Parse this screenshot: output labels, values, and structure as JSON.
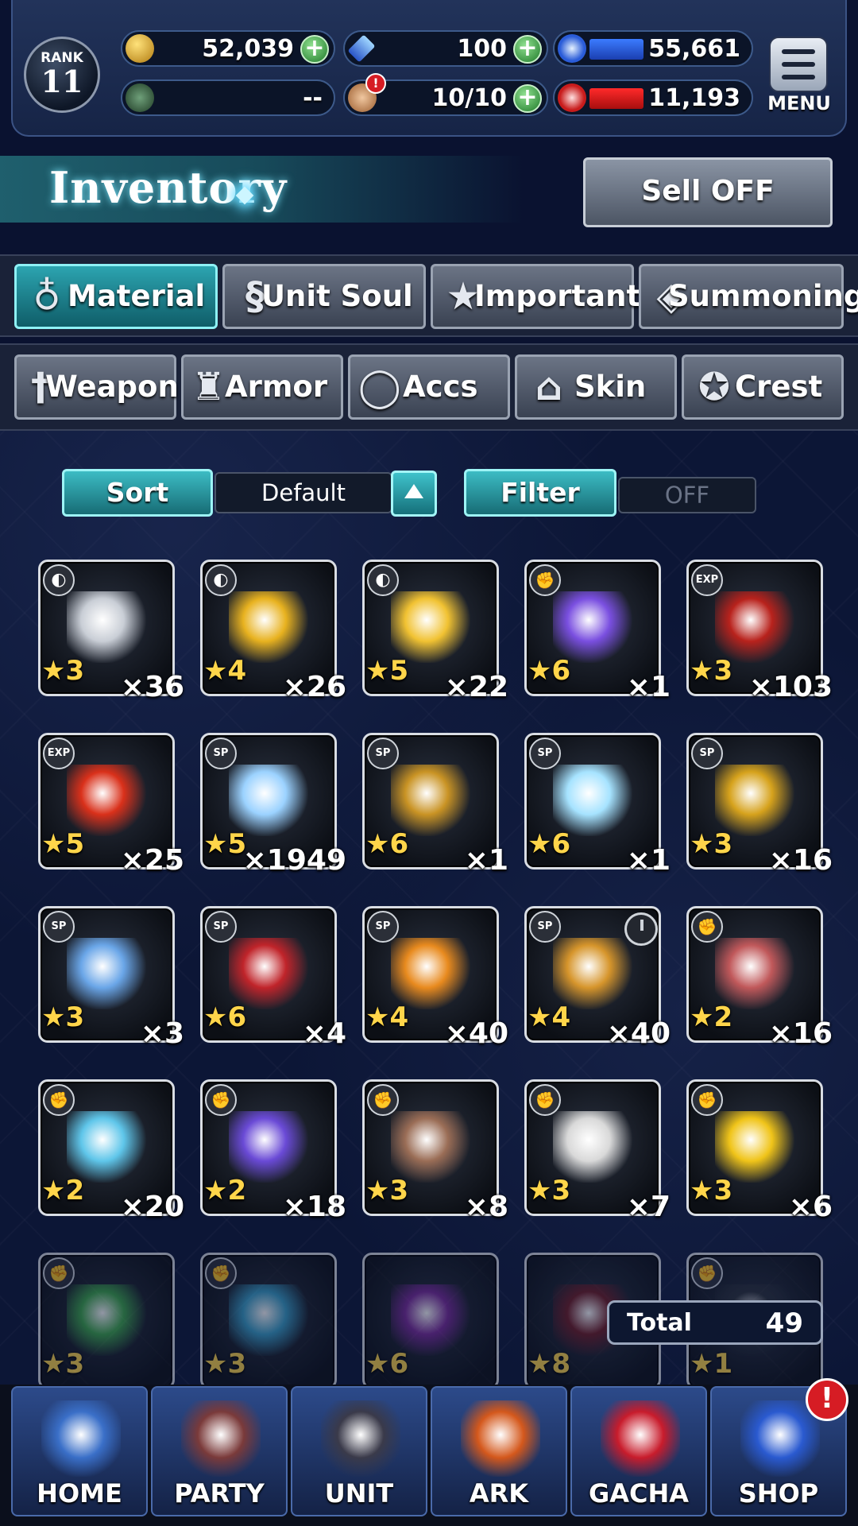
{
  "header": {
    "rank_label": "RANK",
    "rank_value": "11",
    "gold": "52,039",
    "crystals": "100",
    "blue_points": "55,661",
    "equipment": "--",
    "stamina": "10/10",
    "red_points": "11,193",
    "menu_label": "MENU"
  },
  "page": {
    "title": "Inventory",
    "sell_button": "Sell OFF"
  },
  "tabs_row1": [
    {
      "label": "Material",
      "icon": "bag-icon",
      "active": true
    },
    {
      "label": "Unit Soul",
      "icon": "soul-icon"
    },
    {
      "label": "Important",
      "icon": "star-icon"
    },
    {
      "label": "Summoning",
      "icon": "summon-icon"
    }
  ],
  "tabs_row2": [
    {
      "label": "Weapon",
      "icon": "sword-icon"
    },
    {
      "label": "Armor",
      "icon": "armor-icon"
    },
    {
      "label": "Accs",
      "icon": "ring-icon"
    },
    {
      "label": "Skin",
      "icon": "hanger-icon"
    },
    {
      "label": "Crest",
      "icon": "crest-icon"
    }
  ],
  "controls": {
    "sort_label": "Sort",
    "sort_value": "Default",
    "filter_label": "Filter",
    "filter_value": "OFF"
  },
  "items": [
    {
      "name": "silver-ingot",
      "rarity": "★3",
      "count": "×36",
      "badge": "ore",
      "color": "#c9ced6"
    },
    {
      "name": "gold-ingot",
      "rarity": "★4",
      "count": "×26",
      "badge": "ore",
      "color": "#e8b21f"
    },
    {
      "name": "gold-ingot-pile",
      "rarity": "★5",
      "count": "×22",
      "badge": "ore",
      "color": "#f1c232"
    },
    {
      "name": "rainbow-orb",
      "rarity": "★6",
      "count": "×1",
      "badge": "muscle",
      "color": "#7a4fe0"
    },
    {
      "name": "red-exp-potion",
      "rarity": "★3",
      "count": "×103",
      "badge": "EXP",
      "color": "#b8221c"
    },
    {
      "name": "flaming-exp-potion",
      "rarity": "★5",
      "count": "×25",
      "badge": "EXP",
      "color": "#d9301a"
    },
    {
      "name": "soul-mirror",
      "rarity": "★5",
      "count": "×1949",
      "badge": "SP",
      "color": "#9bd2ff"
    },
    {
      "name": "golden-relic",
      "rarity": "★6",
      "count": "×1",
      "badge": "SP",
      "color": "#c99324"
    },
    {
      "name": "prism-crystal",
      "rarity": "★6",
      "count": "×1",
      "badge": "SP",
      "color": "#a6e3ff"
    },
    {
      "name": "gold-ticket",
      "rarity": "★3",
      "count": "×16",
      "badge": "SP",
      "color": "#d6a21c"
    },
    {
      "name": "silver-ticket",
      "rarity": "★3",
      "count": "×3",
      "badge": "SP",
      "color": "#6aa6e8"
    },
    {
      "name": "red-ticket",
      "rarity": "★6",
      "count": "×4",
      "badge": "SP",
      "color": "#c0242a"
    },
    {
      "name": "orange-elixir",
      "rarity": "★4",
      "count": "×40",
      "badge": "SP",
      "color": "#e88a1e"
    },
    {
      "name": "green-elixir-timed",
      "rarity": "★4",
      "count": "×40",
      "badge": "SP",
      "color": "#d6952b",
      "timed": true
    },
    {
      "name": "meat-chunk",
      "rarity": "★2",
      "count": "×16",
      "badge": "muscle",
      "color": "#c0585a"
    },
    {
      "name": "blue-potion",
      "rarity": "★2",
      "count": "×20",
      "badge": "muscle",
      "color": "#5fc6ea"
    },
    {
      "name": "purple-crystals",
      "rarity": "★2",
      "count": "×18",
      "badge": "muscle",
      "color": "#6a4ad6"
    },
    {
      "name": "curled-horn",
      "rarity": "★3",
      "count": "×8",
      "badge": "muscle",
      "color": "#9a6d56"
    },
    {
      "name": "wrapped-gem",
      "rarity": "★3",
      "count": "×7",
      "badge": "muscle",
      "color": "#d9d9d9"
    },
    {
      "name": "golden-apple",
      "rarity": "★3",
      "count": "×6",
      "badge": "muscle",
      "color": "#f0c419"
    },
    {
      "name": "green-potion",
      "rarity": "★3",
      "count": "",
      "badge": "muscle",
      "color": "#3ea84a"
    },
    {
      "name": "blue-bone",
      "rarity": "★3",
      "count": "",
      "badge": "muscle",
      "color": "#3aa0c8"
    },
    {
      "name": "nebula-orb",
      "rarity": "★6",
      "count": "",
      "badge": "",
      "color": "#7a2a9a"
    },
    {
      "name": "dark-red-orb",
      "rarity": "★8",
      "count": "",
      "badge": "",
      "color": "#6e1a22"
    },
    {
      "name": "dark-item",
      "rarity": "★1",
      "count": "",
      "badge": "muscle",
      "color": "#2a2f36"
    }
  ],
  "total": {
    "label": "Total",
    "value": "49"
  },
  "nav": [
    {
      "label": "HOME",
      "color": "#3a6fc8"
    },
    {
      "label": "PARTY",
      "color": "#7a3a3a"
    },
    {
      "label": "UNIT",
      "color": "#3a3a4a"
    },
    {
      "label": "ARK",
      "color": "#d4581c"
    },
    {
      "label": "GACHA",
      "color": "#c81c2c"
    },
    {
      "label": "SHOP",
      "color": "#2a5ad0"
    }
  ],
  "nav_alert": "!"
}
